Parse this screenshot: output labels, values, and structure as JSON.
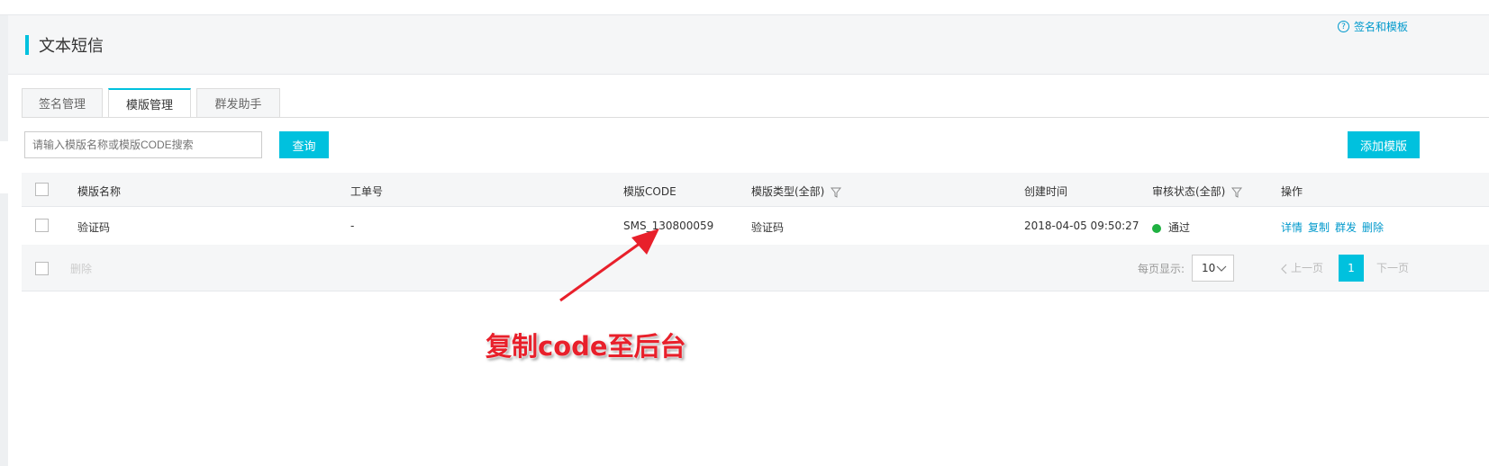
{
  "header": {
    "title": "文本短信",
    "help_link": "签名和模板"
  },
  "tabs": [
    {
      "label": "签名管理",
      "active": false
    },
    {
      "label": "模版管理",
      "active": true
    },
    {
      "label": "群发助手",
      "active": false
    }
  ],
  "search": {
    "placeholder": "请输入模版名称或模版CODE搜索",
    "query_label": "查询"
  },
  "add_template_label": "添加模版",
  "table": {
    "columns": [
      "模版名称",
      "工单号",
      "模版CODE",
      "模版类型(全部)",
      "创建时间",
      "审核状态(全部)",
      "操作"
    ],
    "rows": [
      {
        "name": "验证码",
        "ticket": "-",
        "code": "SMS_130800059",
        "type": "验证码",
        "created": "2018-04-05 09:50:27",
        "status": "通过",
        "actions": [
          "详情",
          "复制",
          "群发",
          "删除"
        ]
      }
    ]
  },
  "footer": {
    "delete_label": "删除",
    "per_page_label": "每页显示:",
    "per_page_value": "10",
    "prev_label": "上一页",
    "current_page": "1",
    "next_label": "下一页"
  },
  "annotation": {
    "text": "复制code至后台"
  },
  "colors": {
    "accent": "#00c1de",
    "link": "#0099cc",
    "status_ok": "#1fb141",
    "annotation": "#e8202b"
  }
}
